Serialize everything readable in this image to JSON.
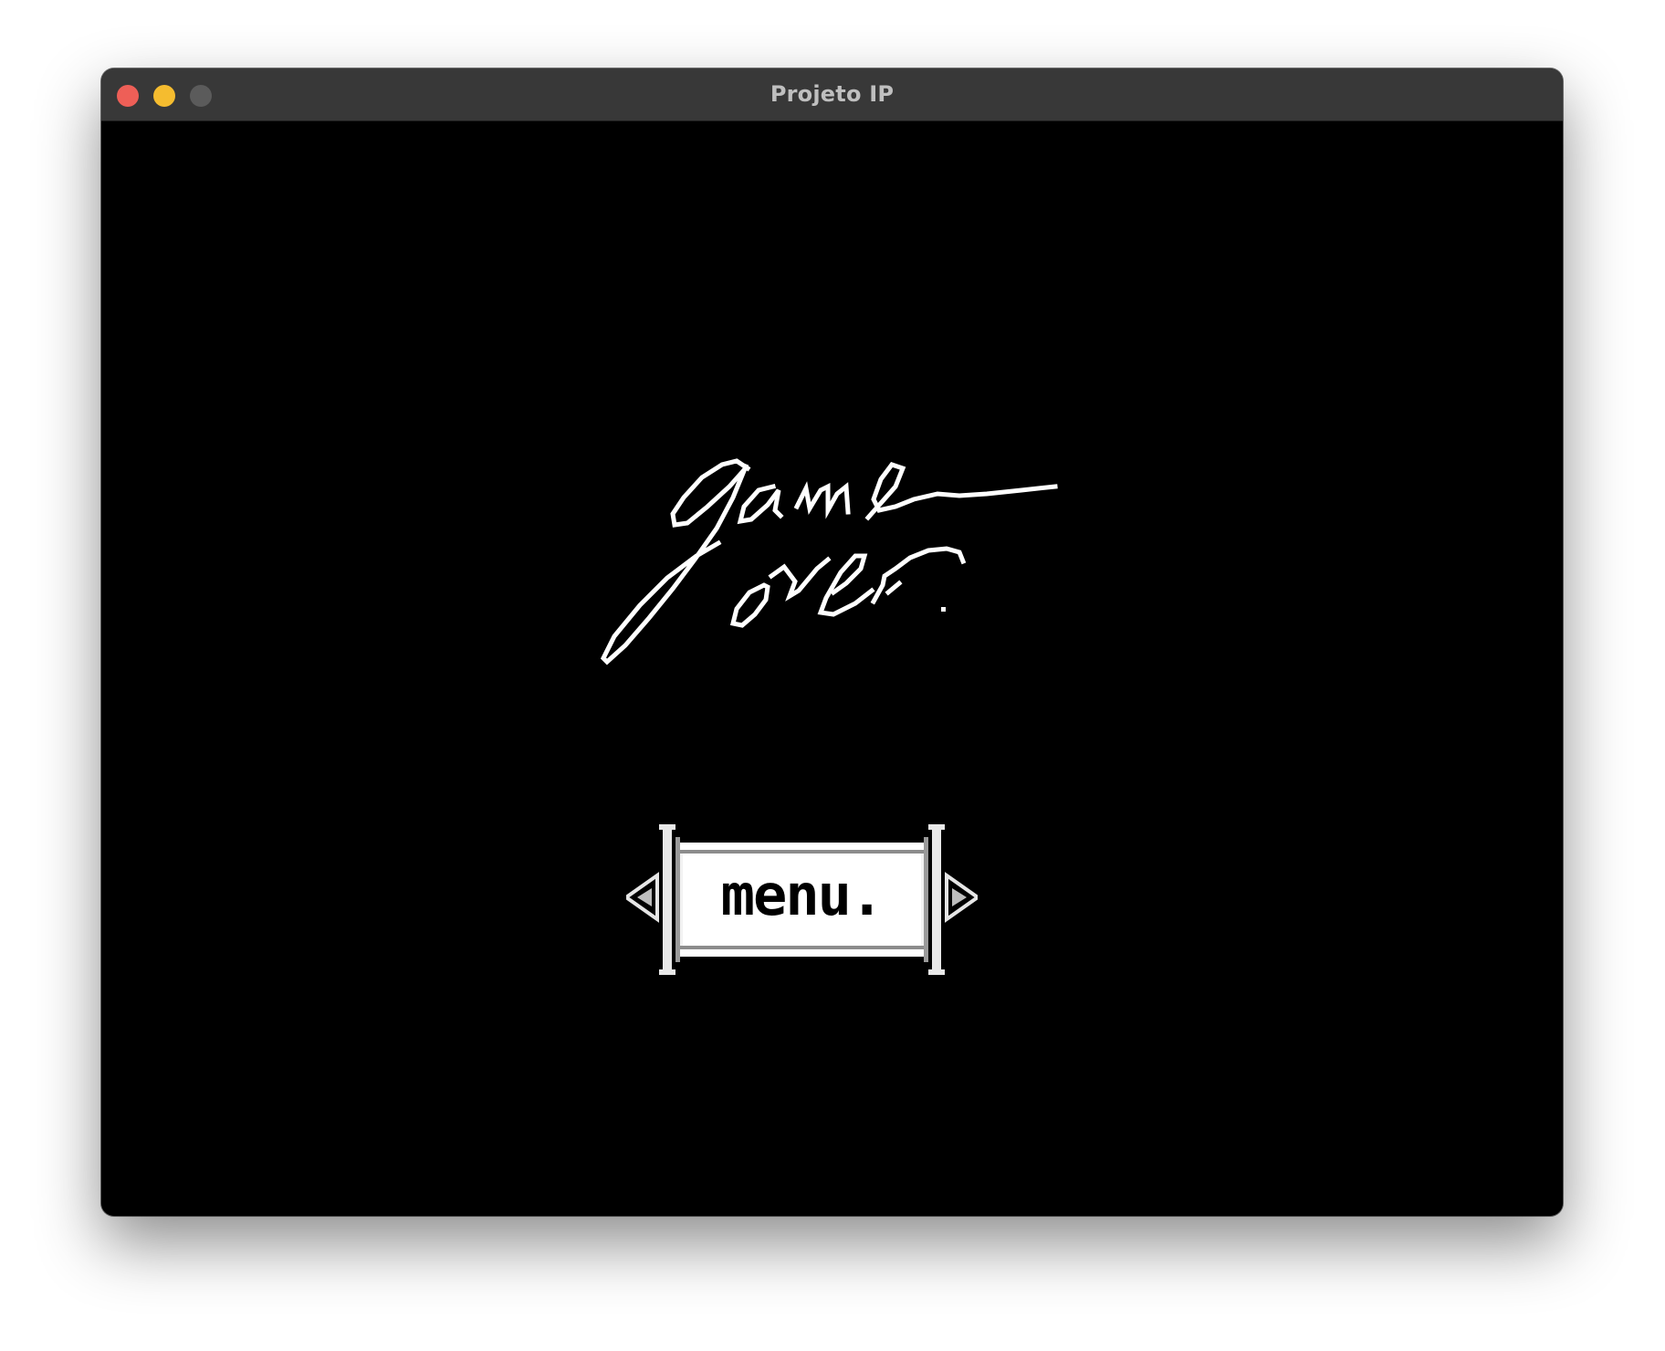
{
  "window": {
    "title": "Projeto IP",
    "controls": [
      "close",
      "minimize",
      "maximize"
    ]
  },
  "game": {
    "screen": "game over",
    "title_art_text": "game over.",
    "menu_button_label": "menu.",
    "background_color": "#000000",
    "art_color": "#ffffff"
  }
}
